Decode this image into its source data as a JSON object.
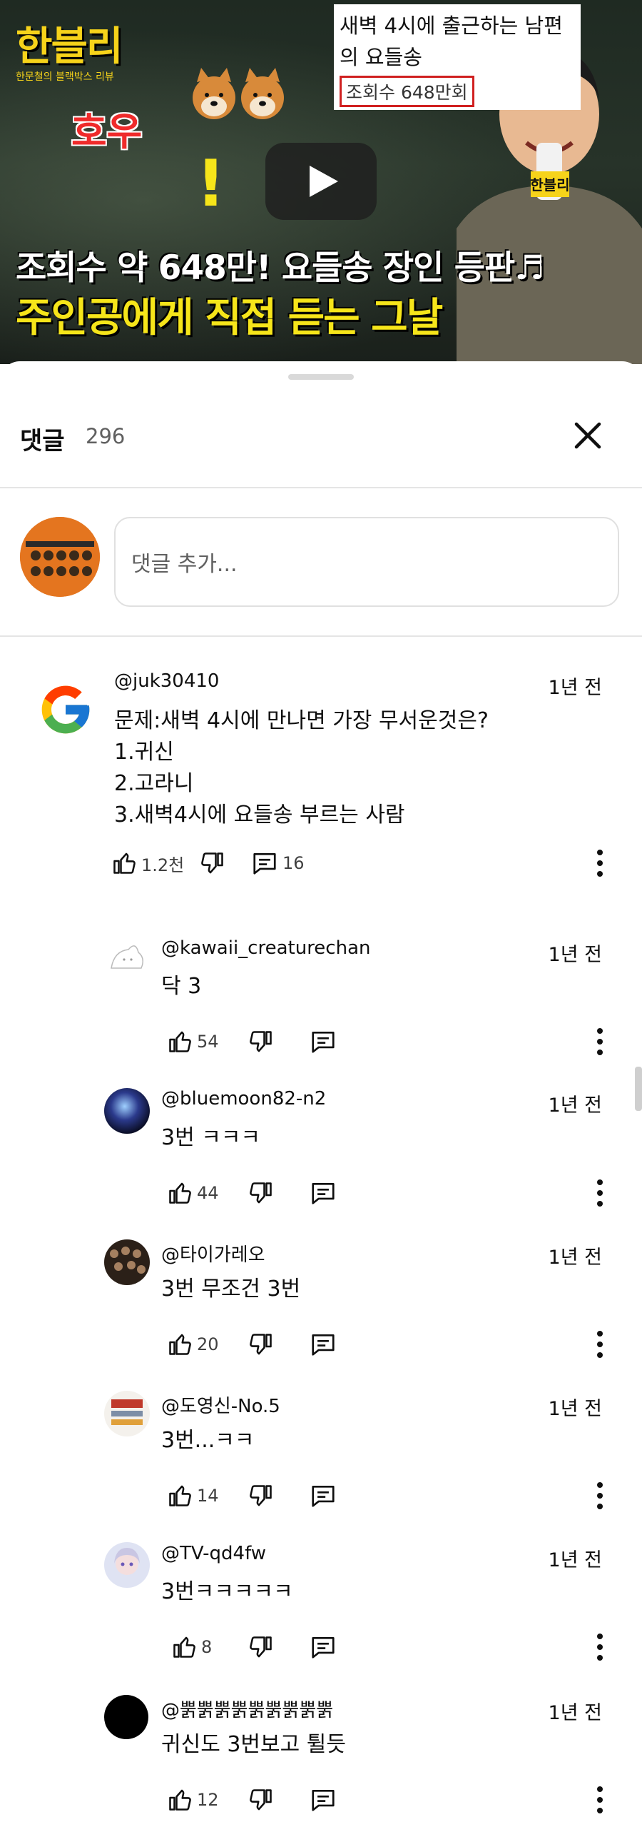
{
  "video": {
    "channel_logo": "한블리",
    "channel_sub": "한문철의 블랙박스 리뷰",
    "exclaim_word": "호우",
    "caption_title": "새벽 4시에 출근하는 남편의 요들송",
    "caption_views": "조회수 648만회",
    "mic_logo": "한블리",
    "line1": "조회수 약 648만! 요들송 장인 등판♬",
    "line2": "주인공에게 직접 듣는 그날"
  },
  "comments_header": {
    "title": "댓글",
    "count": "296"
  },
  "add_comment": {
    "placeholder": "댓글 추가..."
  },
  "comments": [
    {
      "author": "@juk30410",
      "time": "1년 전",
      "text": "문제:새벽 4시에 만나면 가장 무서운것은?\n1.귀신\n2.고라니\n3.새벽4시에 요들송 부르는 사람",
      "likes": "1.2천",
      "replies": "16"
    },
    {
      "author": "@kawaii_creaturechan",
      "time": "1년 전",
      "text": "닥 3",
      "likes": "54"
    },
    {
      "author": "@bluemoon82-n2",
      "time": "1년 전",
      "text": "3번 ㅋㅋㅋ",
      "likes": "44"
    },
    {
      "author": "@타이가레오",
      "time": "1년 전",
      "text": "3번 무조건 3번",
      "likes": "20"
    },
    {
      "author": "@도영신-No.5",
      "time": "1년 전",
      "text": "3번...ㅋㅋ",
      "likes": "14"
    },
    {
      "author": "@TV-qd4fw",
      "time": "1년 전",
      "text": "3번ㅋㅋㅋㅋㅋ",
      "likes": "8"
    },
    {
      "author": "@뿕뿕뿕뿕뿕뿕뿕뿕뿕",
      "time": "1년 전",
      "text": "귀신도 3번보고 튈듯",
      "likes": "12"
    }
  ],
  "colors": {
    "accent_yellow": "#f6e51a",
    "accent_red": "#ef2b2b",
    "text_primary": "#0f0f0f",
    "text_secondary": "#606060"
  },
  "icons": [
    "play-icon",
    "close-icon",
    "like-icon",
    "dislike-icon",
    "reply-icon",
    "more-vert-icon",
    "google-g-icon"
  ]
}
